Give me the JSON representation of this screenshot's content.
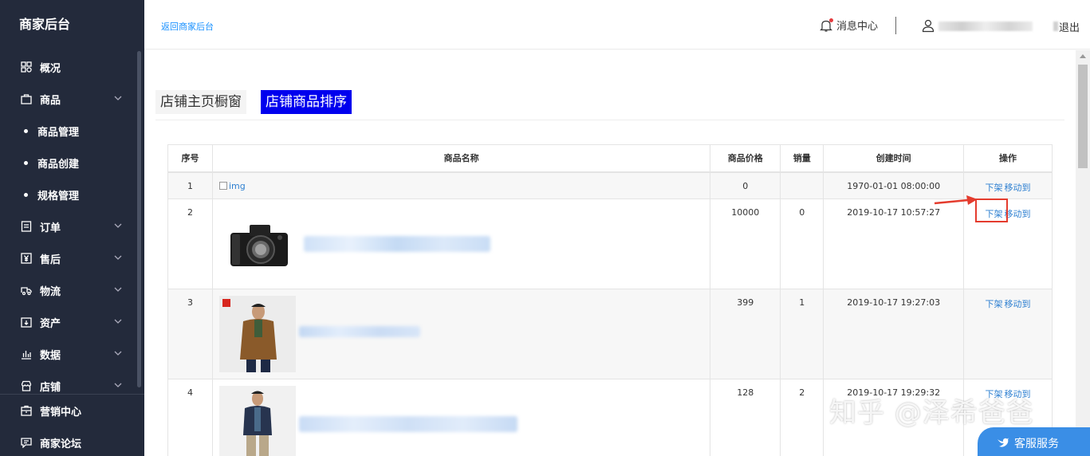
{
  "sidebar": {
    "title": "商家后台",
    "items": [
      {
        "label": "概况",
        "icon": "grid-icon",
        "expandable": false
      },
      {
        "label": "商品",
        "icon": "bag-icon",
        "expandable": true
      },
      {
        "label": "商品管理",
        "sub": true
      },
      {
        "label": "商品创建",
        "sub": true
      },
      {
        "label": "规格管理",
        "sub": true
      },
      {
        "label": "订单",
        "icon": "list-icon",
        "expandable": true
      },
      {
        "label": "售后",
        "icon": "yen-icon",
        "expandable": true
      },
      {
        "label": "物流",
        "icon": "truck-icon",
        "expandable": true
      },
      {
        "label": "资产",
        "icon": "wallet-icon",
        "expandable": true
      },
      {
        "label": "数据",
        "icon": "bar-chart-icon",
        "expandable": true
      },
      {
        "label": "店铺",
        "icon": "store-icon",
        "expandable": true
      }
    ],
    "bottom": [
      {
        "label": "营销中心",
        "icon": "marketing-icon"
      },
      {
        "label": "商家论坛",
        "icon": "forum-icon"
      }
    ]
  },
  "topbar": {
    "back_link": "返回商家后台",
    "message_center": "消息中心",
    "logout": "退出"
  },
  "tabs": [
    {
      "label": "店铺主页橱窗",
      "active": false
    },
    {
      "label": "店铺商品排序",
      "active": true
    }
  ],
  "table": {
    "headers": [
      "序号",
      "商品名称",
      "商品价格",
      "销量",
      "创建时间",
      "操作"
    ],
    "rows": [
      {
        "index": "1",
        "name": "img",
        "price": "0",
        "sales": "",
        "created": "1970-01-01 08:00:00",
        "op1": "下架",
        "op2": "移动到"
      },
      {
        "index": "2",
        "name": "",
        "price": "10000",
        "sales": "0",
        "created": "2019-10-17 10:57:27",
        "op1": "下架",
        "op2": "移动到"
      },
      {
        "index": "3",
        "name": "",
        "price": "399",
        "sales": "1",
        "created": "2019-10-17 19:27:03",
        "op1": "下架",
        "op2": "移动到"
      },
      {
        "index": "4",
        "name": "",
        "price": "128",
        "sales": "2",
        "created": "2019-10-17 19:29:32",
        "op1": "下架",
        "op2": "移动到"
      }
    ]
  },
  "watermark": "知乎 @泽希爸爸",
  "service_button": "客服服务",
  "colors": {
    "sidebar_bg": "#232a3b",
    "link": "#2f80d1",
    "active_tab": "#0000ee",
    "highlight": "#e43c2e",
    "service": "#3a8ee6"
  }
}
